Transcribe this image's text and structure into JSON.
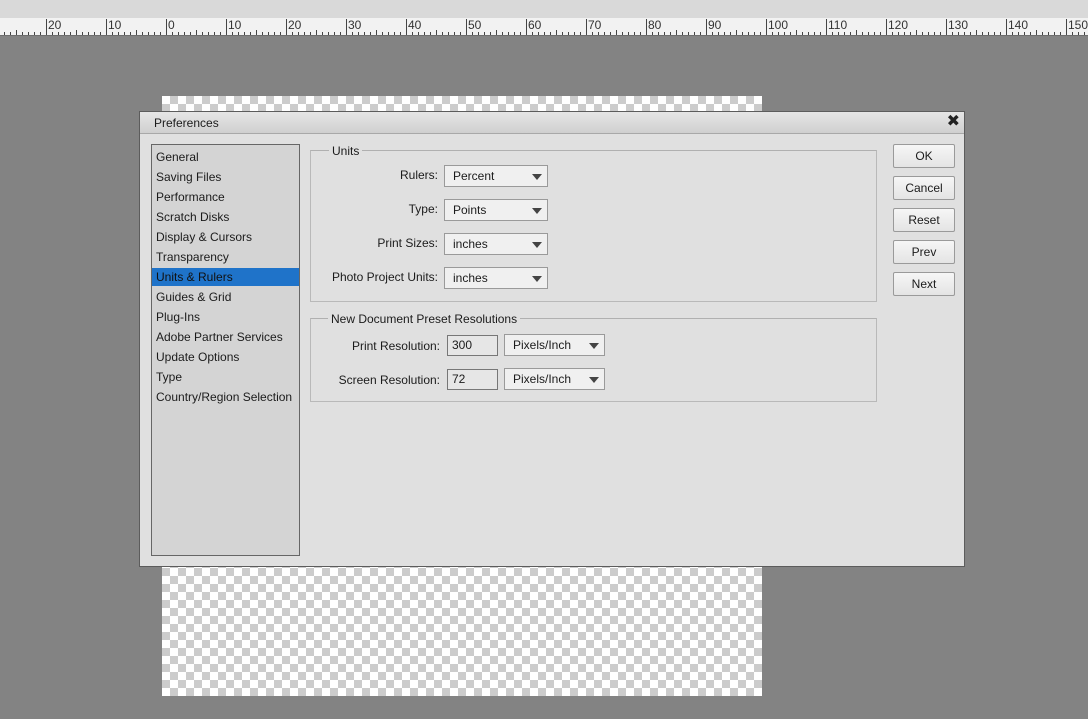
{
  "ruler": {
    "labels": [
      "20",
      "10",
      "0",
      "10",
      "20",
      "30",
      "40",
      "50",
      "60",
      "70",
      "80",
      "90",
      "100",
      "110",
      "120",
      "130",
      "140",
      "150"
    ]
  },
  "dialog": {
    "title": "Preferences",
    "close_glyph": "✖"
  },
  "categories": [
    {
      "label": "General"
    },
    {
      "label": "Saving Files"
    },
    {
      "label": "Performance"
    },
    {
      "label": "Scratch Disks"
    },
    {
      "label": "Display & Cursors"
    },
    {
      "label": "Transparency"
    },
    {
      "label": "Units & Rulers",
      "selected": true
    },
    {
      "label": "Guides & Grid"
    },
    {
      "label": "Plug-Ins"
    },
    {
      "label": "Adobe Partner Services"
    },
    {
      "label": "Update Options"
    },
    {
      "label": "Type"
    },
    {
      "label": "Country/Region Selection"
    }
  ],
  "units": {
    "legend": "Units",
    "rulers_label": "Rulers:",
    "rulers_value": "Percent",
    "type_label": "Type:",
    "type_value": "Points",
    "print_sizes_label": "Print Sizes:",
    "print_sizes_value": "inches",
    "photo_project_label": "Photo Project Units:",
    "photo_project_value": "inches"
  },
  "resolutions": {
    "legend": "New Document Preset Resolutions",
    "print_label": "Print Resolution:",
    "print_value": "300",
    "print_unit": "Pixels/Inch",
    "screen_label": "Screen Resolution:",
    "screen_value": "72",
    "screen_unit": "Pixels/Inch"
  },
  "buttons": {
    "ok": "OK",
    "cancel": "Cancel",
    "reset": "Reset",
    "prev": "Prev",
    "next": "Next"
  },
  "colors": {
    "selection": "#1f73c9",
    "workspace": "#838383",
    "dialog_bg": "#e0e0e0"
  }
}
